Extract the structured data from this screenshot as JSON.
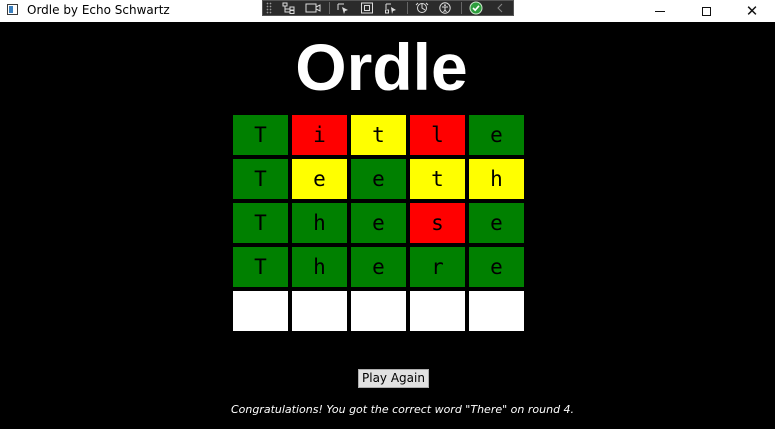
{
  "window": {
    "title": "Ordle by Echo Schwartz",
    "controls": {
      "minimize": "minimize",
      "maximize": "maximize",
      "close": "✕"
    }
  },
  "debug_toolbar": {
    "icons": [
      "live-visual-tree-icon",
      "record-icon",
      "select-element-icon",
      "display-adorners-icon",
      "track-focus-icon",
      "hot-reload-icon",
      "accessibility-icon",
      "binding-status-ok-icon",
      "collapse-chevron-icon"
    ],
    "colors": {
      "background": "#2b2b2b",
      "status_ok": "#2e9e3e"
    }
  },
  "app": {
    "title": "Ordle",
    "board": [
      [
        {
          "letter": "T",
          "state": "green"
        },
        {
          "letter": "i",
          "state": "red"
        },
        {
          "letter": "t",
          "state": "yellow"
        },
        {
          "letter": "l",
          "state": "red"
        },
        {
          "letter": "e",
          "state": "green"
        }
      ],
      [
        {
          "letter": "T",
          "state": "green"
        },
        {
          "letter": "e",
          "state": "yellow"
        },
        {
          "letter": "e",
          "state": "green"
        },
        {
          "letter": "t",
          "state": "yellow"
        },
        {
          "letter": "h",
          "state": "yellow"
        }
      ],
      [
        {
          "letter": "T",
          "state": "green"
        },
        {
          "letter": "h",
          "state": "green"
        },
        {
          "letter": "e",
          "state": "green"
        },
        {
          "letter": "s",
          "state": "red"
        },
        {
          "letter": "e",
          "state": "green"
        }
      ],
      [
        {
          "letter": "T",
          "state": "green"
        },
        {
          "letter": "h",
          "state": "green"
        },
        {
          "letter": "e",
          "state": "green"
        },
        {
          "letter": "r",
          "state": "green"
        },
        {
          "letter": "e",
          "state": "green"
        }
      ],
      [
        {
          "letter": "",
          "state": "empty"
        },
        {
          "letter": "",
          "state": "empty"
        },
        {
          "letter": "",
          "state": "empty"
        },
        {
          "letter": "",
          "state": "empty"
        },
        {
          "letter": "",
          "state": "empty"
        }
      ]
    ],
    "play_again_label": "Play Again",
    "status_message": "Congratulations! You got the correct word \"There\" on round 4.",
    "colors": {
      "correct": "#008000",
      "misplaced": "#ffff00",
      "absent": "#ff0000",
      "empty": "#ffffff",
      "background": "#000000"
    }
  }
}
